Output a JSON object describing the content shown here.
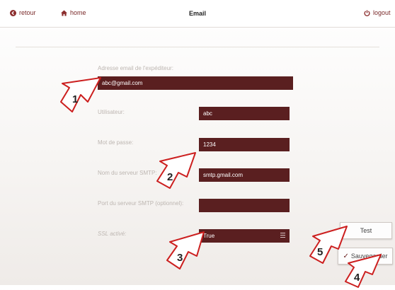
{
  "nav": {
    "back_label": "retour",
    "home_label": "home",
    "title": "Email",
    "logout_label": "logout"
  },
  "form": {
    "sender_email": {
      "label": "Adresse email de l'expéditeur:",
      "value": "abc@gmail.com"
    },
    "username": {
      "label": "Utilisateur:",
      "value": "abc"
    },
    "password": {
      "label": "Mot de passe:",
      "value": "1234"
    },
    "smtp_server": {
      "label": "Nom du serveur SMTP:",
      "value": "smtp.gmail.com"
    },
    "smtp_port": {
      "label": "Port du serveur SMTP (optionnel):",
      "value": ""
    },
    "ssl": {
      "label": "SSL activé:",
      "value": "True"
    }
  },
  "buttons": {
    "test_label": "Test",
    "save_label": "Sauvegarder"
  },
  "annotations": [
    "1",
    "2",
    "3",
    "4",
    "5"
  ],
  "colors": {
    "field_bg": "#5a1f20",
    "nav_accent": "#7a2a2a",
    "callout_fill": "#ffffff",
    "callout_stroke": "#cc1f1f"
  }
}
